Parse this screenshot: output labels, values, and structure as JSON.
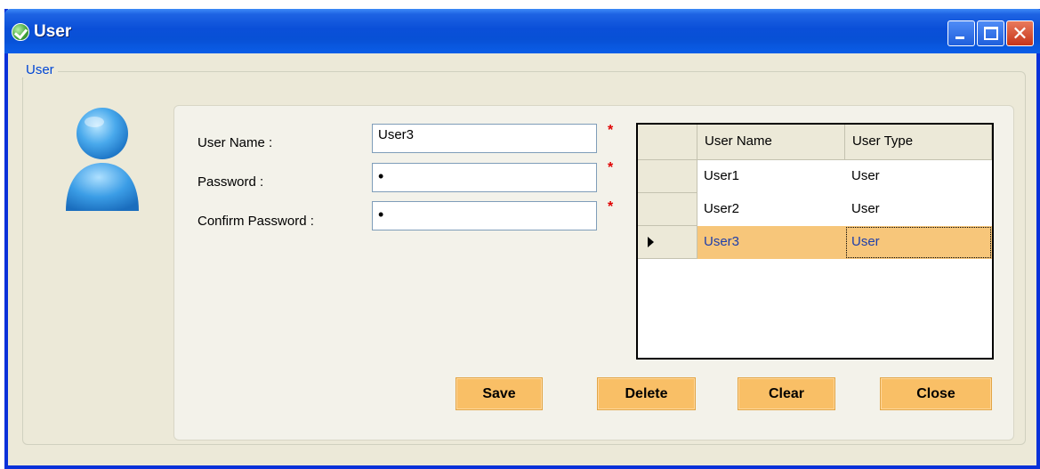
{
  "window": {
    "title": "User"
  },
  "group": {
    "title": "User"
  },
  "form": {
    "username_label": "User Name :",
    "username_value": "User3",
    "password_label": "Password :",
    "password_value": "•",
    "confirm_label": "Confirm Password :",
    "confirm_value": "•",
    "required_marker": "*"
  },
  "grid": {
    "columns": [
      "User Name",
      "User Type"
    ],
    "rows": [
      {
        "name": "User1",
        "type": "User"
      },
      {
        "name": "User2",
        "type": "User"
      },
      {
        "name": "User3",
        "type": "User",
        "selected": true
      }
    ]
  },
  "buttons": {
    "save": "Save",
    "delete": "Delete",
    "clear": "Clear",
    "close": "Close"
  },
  "colors": {
    "title_bar": "#0a4fd8",
    "window_bg": "#ece9d8",
    "button_bg": "#f9bf66",
    "selected_row": "#f7c67a",
    "required": "#e00000",
    "group_title": "#0046d5"
  },
  "icons": {
    "app": "check-circle-icon",
    "avatar": "user-avatar-icon",
    "row_indicator": "row-pointer-icon"
  }
}
